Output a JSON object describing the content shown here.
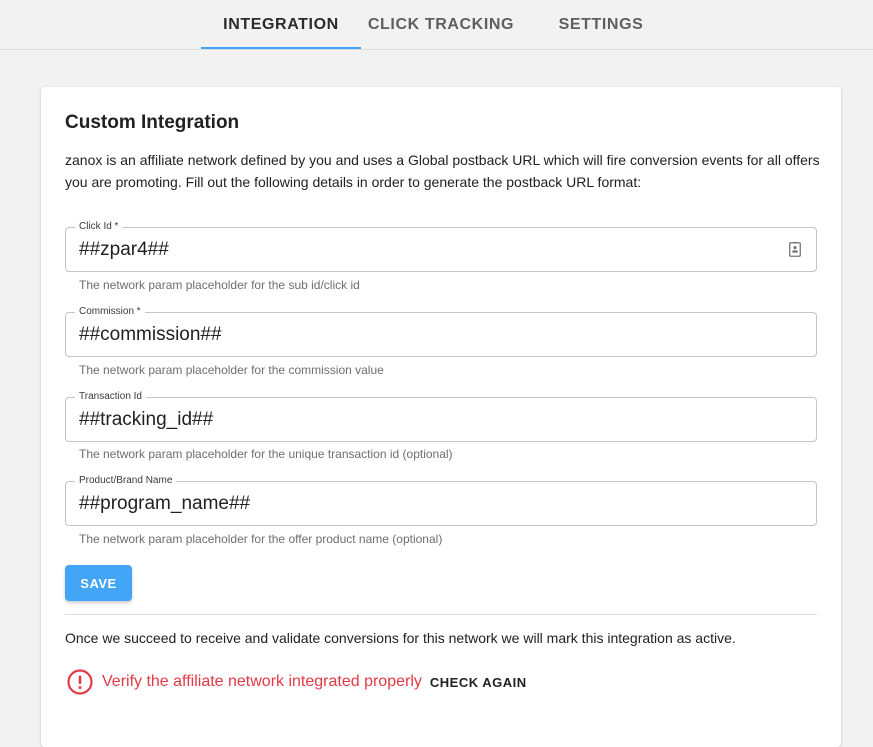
{
  "tabs": [
    {
      "label": "INTEGRATION",
      "active": true
    },
    {
      "label": "CLICK TRACKING",
      "active": false
    },
    {
      "label": "SETTINGS",
      "active": false
    }
  ],
  "colors": {
    "accent": "#42a5f5",
    "error": "#e53945"
  },
  "card": {
    "title": "Custom Integration",
    "description": "zanox is an affiliate network defined by you and uses a Global postback URL which will fire conversion events for all offers you are promoting. Fill out the following details in order to generate the postback URL format:"
  },
  "fields": [
    {
      "label": "Click Id *",
      "value": "##zpar4##",
      "helper": "The network param placeholder for the sub id/click id",
      "icon": "contact-card-icon"
    },
    {
      "label": "Commission *",
      "value": "##commission##",
      "helper": "The network param placeholder for the commission value"
    },
    {
      "label": "Transaction Id",
      "value": "##tracking_id##",
      "helper": "The network param placeholder for the unique transaction id (optional)"
    },
    {
      "label": "Product/Brand Name",
      "value": "##program_name##",
      "helper": "The network param placeholder for the offer product name (optional)"
    }
  ],
  "save_label": "SAVE",
  "status_text": "Once we succeed to receive and validate conversions for this network we will mark this integration as active.",
  "verify": {
    "message": "Verify the affiliate network integrated properly",
    "check_again_label": "CHECK AGAIN",
    "icon": "error-circle-icon"
  }
}
